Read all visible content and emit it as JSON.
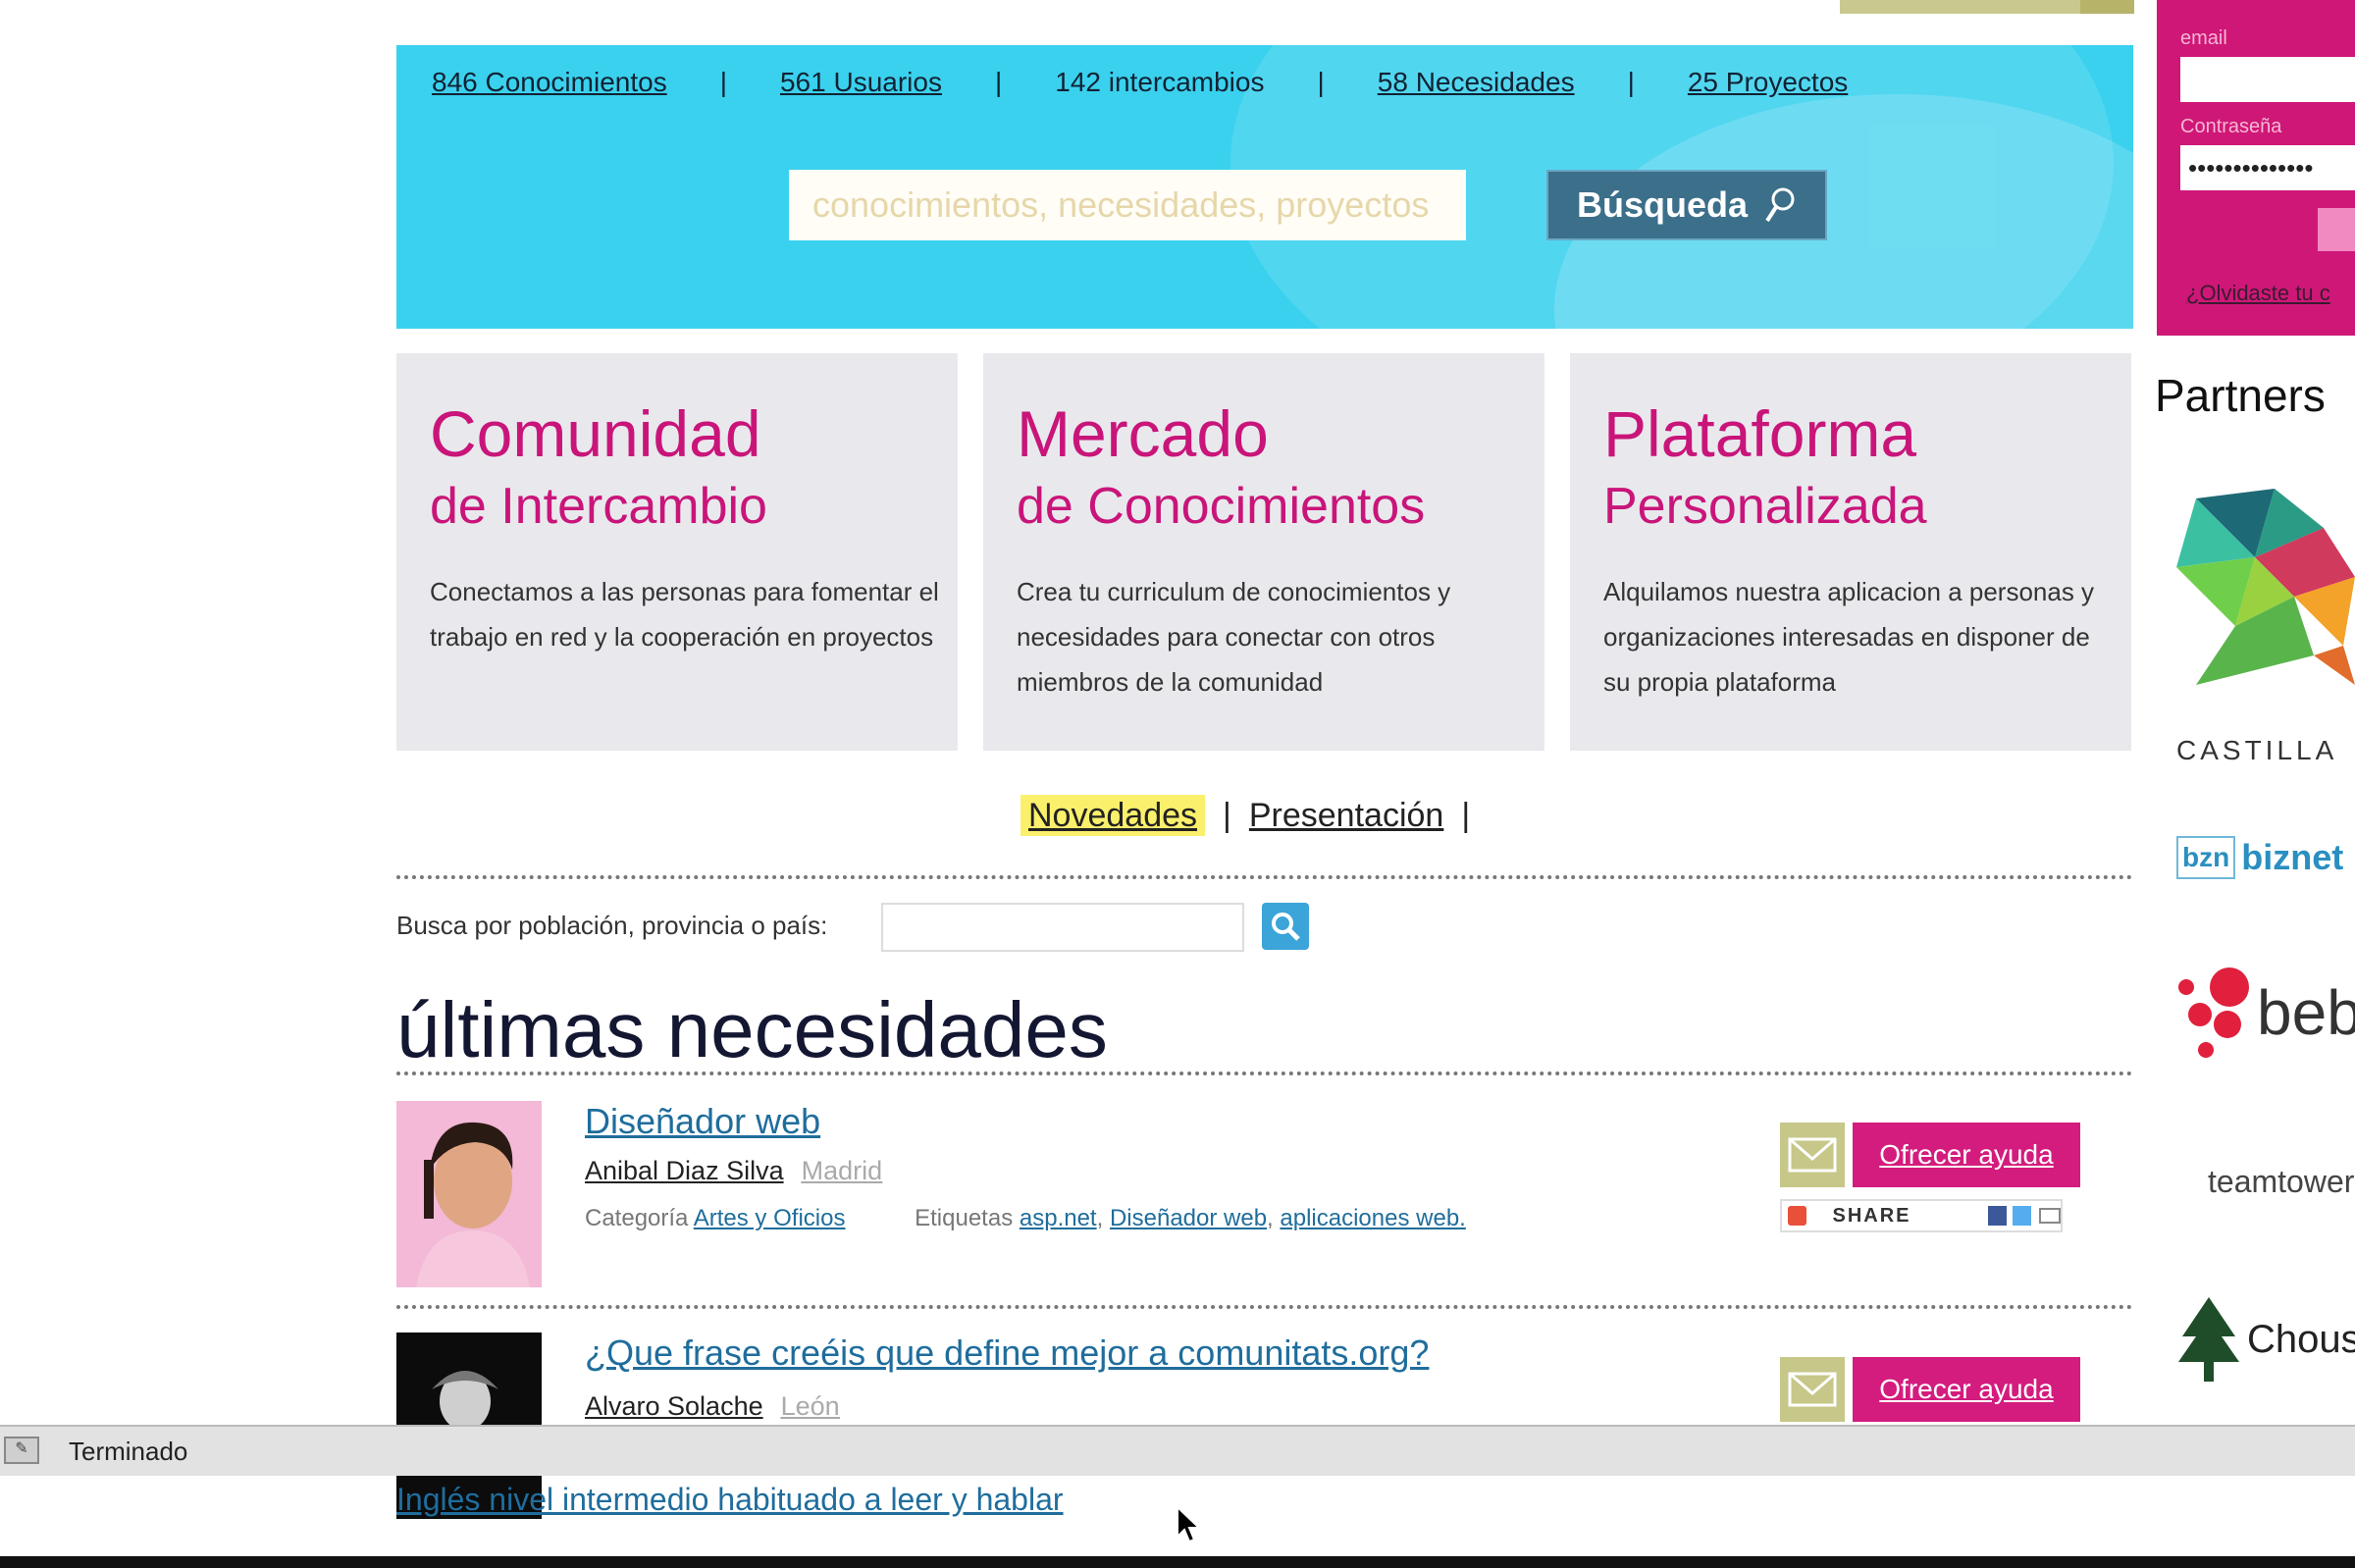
{
  "stats": {
    "conocimientos": "846 Conocimientos",
    "usuarios": "561 Usuarios",
    "intercambios": "142 intercambios",
    "necesidades": "58 Necesidades",
    "proyectos": "25 Proyectos"
  },
  "search": {
    "placeholder": "conocimientos, necesidades, proyectos",
    "button_label": "Búsqueda"
  },
  "features": [
    {
      "title": "Comunidad",
      "subtitle": "de Intercambio",
      "text": "Conectamos a las personas para fomentar el trabajo en red y la cooperación en proyectos"
    },
    {
      "title": "Mercado",
      "subtitle": "de Conocimientos",
      "text": "Crea tu curriculum de conocimientos y necesidades para conectar con otros miembros de la comunidad"
    },
    {
      "title": "Plataforma",
      "subtitle": "Personalizada",
      "text": "Alquilamos nuestra aplicacion a personas y organizaciones interesadas en disponer de su propia plataforma"
    }
  ],
  "tabs": {
    "novedades": "Novedades",
    "presentacion": "Presentación",
    "separator": "|"
  },
  "location_search": {
    "label": "Busca por población, provincia o país:"
  },
  "section_title": "últimas necesidades",
  "needs": [
    {
      "title": "Diseñador web",
      "user": "Anibal Diaz Silva",
      "location": "Madrid",
      "category_label": "Categoría",
      "category": "Artes y Oficios",
      "tags_label": "Etiquetas",
      "tags": [
        "asp.net",
        "Diseñador web",
        "aplicaciones web."
      ],
      "offer_label": "Ofrecer ayuda",
      "share_label": "SHARE"
    },
    {
      "title": "¿Que frase creéis que define mejor a comunitats.org?",
      "user": "Alvaro Solache",
      "location": "León",
      "offer_label": "Ofrecer ayuda"
    }
  ],
  "login": {
    "email_label": "email",
    "password_label": "Contraseña",
    "password_value": "••••••••••••••",
    "forgot_label": "¿Olvidaste tu c"
  },
  "partners": {
    "title": "Partners",
    "items": [
      "CASTILLA",
      "biznet",
      "beb",
      "teamtower",
      "Chous"
    ]
  },
  "status_bar": {
    "text": "Terminado"
  },
  "next_need_title": "Inglés nivel intermedio habituado a leer y hablar",
  "colors": {
    "banner": "#3ad1ee",
    "magenta": "#c9157a",
    "search_button": "#3b6f8a",
    "highlight": "#fbf06c"
  }
}
